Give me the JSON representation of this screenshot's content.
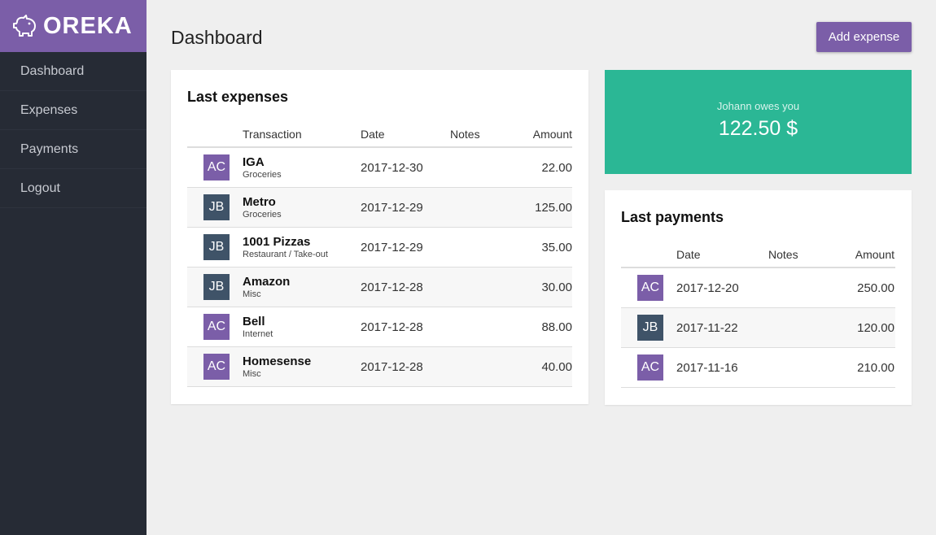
{
  "brand": {
    "name": "OREKA",
    "icon": "piggy-bank-icon",
    "color": "#7b5ea8"
  },
  "nav": [
    {
      "label": "Dashboard"
    },
    {
      "label": "Expenses"
    },
    {
      "label": "Payments"
    },
    {
      "label": "Logout"
    }
  ],
  "header": {
    "title": "Dashboard",
    "add_label": "Add expense"
  },
  "expenses": {
    "title": "Last expenses",
    "columns": [
      "Transaction",
      "Date",
      "Notes",
      "Amount"
    ],
    "rows": [
      {
        "initials": "AC",
        "color": "purple",
        "merchant": "IGA",
        "category": "Groceries",
        "date": "2017-12-30",
        "notes": "",
        "amount": "22.00"
      },
      {
        "initials": "JB",
        "color": "slate",
        "merchant": "Metro",
        "category": "Groceries",
        "date": "2017-12-29",
        "notes": "",
        "amount": "125.00"
      },
      {
        "initials": "JB",
        "color": "slate",
        "merchant": "1001 Pizzas",
        "category": "Restaurant / Take-out",
        "date": "2017-12-29",
        "notes": "",
        "amount": "35.00"
      },
      {
        "initials": "JB",
        "color": "slate",
        "merchant": "Amazon",
        "category": "Misc",
        "date": "2017-12-28",
        "notes": "",
        "amount": "30.00"
      },
      {
        "initials": "AC",
        "color": "purple",
        "merchant": "Bell",
        "category": "Internet",
        "date": "2017-12-28",
        "notes": "",
        "amount": "88.00"
      },
      {
        "initials": "AC",
        "color": "purple",
        "merchant": "Homesense",
        "category": "Misc",
        "date": "2017-12-28",
        "notes": "",
        "amount": "40.00"
      }
    ]
  },
  "balance": {
    "label": "Johann owes you",
    "amount": "122.50 $",
    "color": "#2bb795"
  },
  "payments": {
    "title": "Last payments",
    "columns": [
      "Date",
      "Notes",
      "Amount"
    ],
    "rows": [
      {
        "initials": "AC",
        "color": "purple",
        "date": "2017-12-20",
        "notes": "",
        "amount": "250.00"
      },
      {
        "initials": "JB",
        "color": "slate",
        "date": "2017-11-22",
        "notes": "",
        "amount": "120.00"
      },
      {
        "initials": "AC",
        "color": "purple",
        "date": "2017-11-16",
        "notes": "",
        "amount": "210.00"
      }
    ]
  }
}
